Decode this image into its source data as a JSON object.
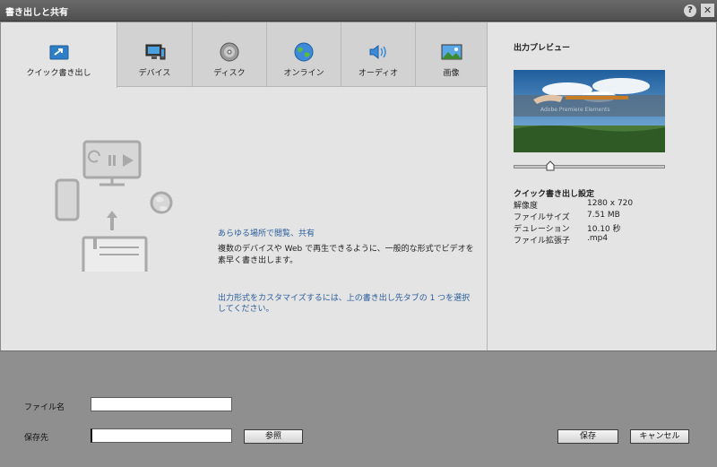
{
  "window": {
    "title": "書き出しと共有",
    "help_glyph": "?",
    "close_glyph": "✕"
  },
  "tabs": [
    {
      "label": "クイック書き出し",
      "icon": "quick-export-icon"
    },
    {
      "label": "デバイス",
      "icon": "device-icon"
    },
    {
      "label": "ディスク",
      "icon": "disc-icon"
    },
    {
      "label": "オンライン",
      "icon": "globe-icon"
    },
    {
      "label": "オーディオ",
      "icon": "speaker-icon"
    },
    {
      "label": "画像",
      "icon": "image-icon"
    }
  ],
  "content": {
    "heading": "あらゆる場所で閲覧、共有",
    "description": "複数のデバイスや Web で再生できるように、一般的な形式でビデオを素早く書き出します。",
    "hint": "出力形式をカスタマイズするには、上の書き出し先タブの 1 つを選択してください。"
  },
  "preview": {
    "title": "出力プレビュー",
    "thumbnail_caption": "Adobe Premiere Elements",
    "slider_position": 0.24
  },
  "settings": {
    "title": "クイック書き出し設定",
    "rows": [
      {
        "label": "解像度",
        "value": "1280 x 720"
      },
      {
        "label": "ファイルサイズ",
        "value": "7.51 MB"
      },
      {
        "label": "デュレーション",
        "value": "10.10 秒"
      },
      {
        "label": "ファイル拡張子",
        "value": ".mp4"
      }
    ]
  },
  "form": {
    "filename_label": "ファイル名",
    "filename_value": "",
    "save_location_label": "保存先",
    "save_location_value": "",
    "browse_label": "参照",
    "save_label": "保存",
    "cancel_label": "キャンセル"
  },
  "colors": {
    "link": "#2a5d9a",
    "tab_active": "#e4e4e4",
    "tab_inactive": "#d2d2d2",
    "footer": "#8f8f8f"
  }
}
